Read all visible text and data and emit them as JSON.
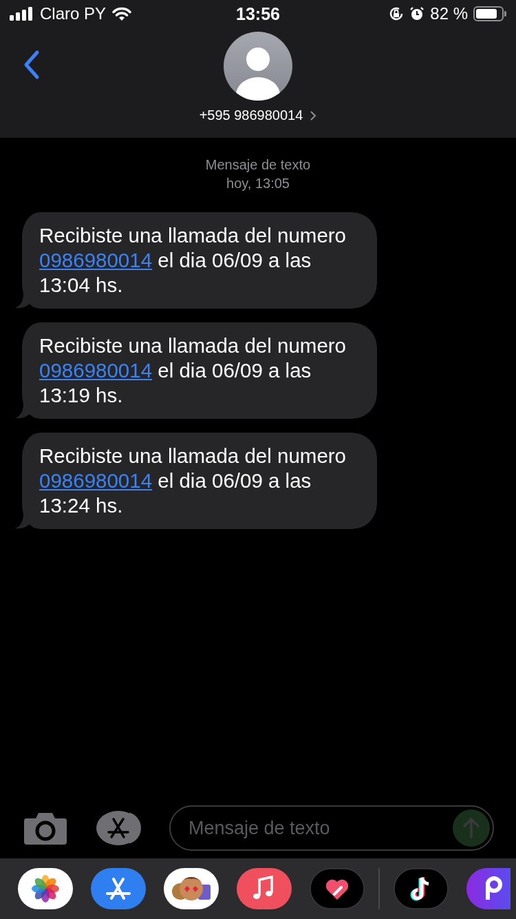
{
  "status_bar": {
    "carrier": "Claro PY",
    "time": "13:56",
    "battery": "82 %"
  },
  "header": {
    "contact": "+595 986980014"
  },
  "thread": {
    "service": "Mensaje de texto",
    "date": "hoy, 13:05"
  },
  "messages": [
    {
      "before": "Recibiste una llamada del numero ",
      "link": "0986980014",
      "after": " el dia 06/09 a las 13:04 hs."
    },
    {
      "before": "Recibiste una llamada del numero ",
      "link": "0986980014",
      "after": " el dia 06/09 a las 13:19 hs."
    },
    {
      "before": "Recibiste una llamada del numero ",
      "link": "0986980014",
      "after": " el dia 06/09 a las 13:24 hs."
    }
  ],
  "composer": {
    "placeholder": "Mensaje de texto"
  },
  "dock": [
    {
      "kind": "photos"
    },
    {
      "kind": "store"
    },
    {
      "kind": "stickers"
    },
    {
      "kind": "music"
    },
    {
      "kind": "heart"
    },
    {
      "kind": "divider"
    },
    {
      "kind": "note"
    },
    {
      "kind": "purple"
    }
  ]
}
